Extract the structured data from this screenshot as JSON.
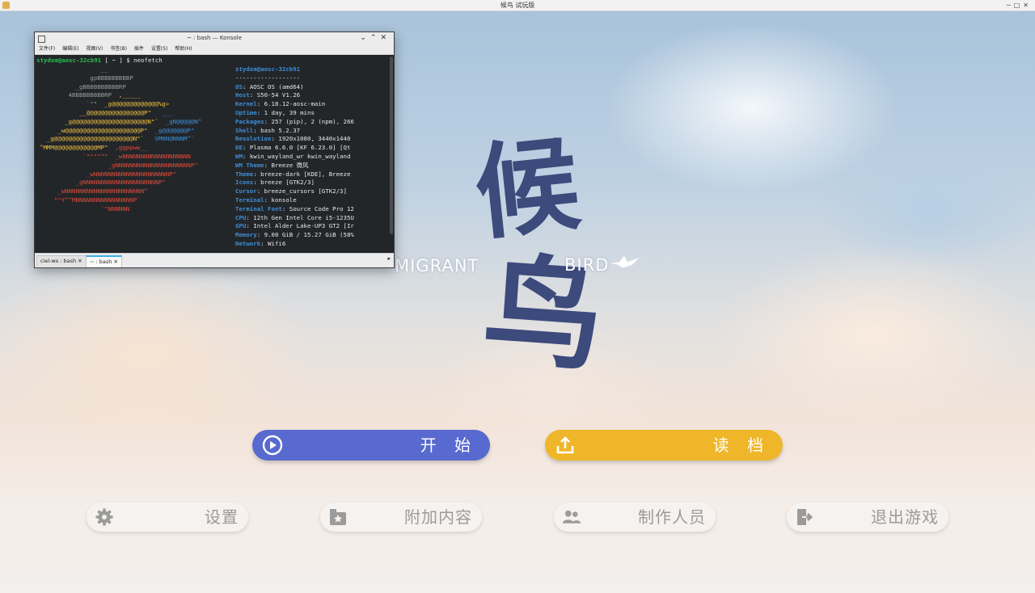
{
  "window": {
    "title": "候鸟 试玩版"
  },
  "terminal": {
    "title": "~ : bash — Konsole",
    "menu": [
      "文件(F)",
      "编辑(E)",
      "视图(V)",
      "书签(B)",
      "插件",
      "设置(S)",
      "帮助(H)"
    ],
    "prompt_user": "stydxm@aosc-32cb91",
    "prompt_rest": " [ ~ ] $ neofetch",
    "host_line": "stydxm@aosc-32cb91",
    "separator": "------------------",
    "info": [
      {
        "key": "OS",
        "value": "AOSC OS (amd64)"
      },
      {
        "key": "Host",
        "value": "S50-54 V1.26"
      },
      {
        "key": "Kernel",
        "value": "6.18.12-aosc-main"
      },
      {
        "key": "Uptime",
        "value": "1 day, 39 mins"
      },
      {
        "key": "Packages",
        "value": "257 (pip), 2 (npm), 266"
      },
      {
        "key": "Shell",
        "value": "bash 5.2.37"
      },
      {
        "key": "Resolution",
        "value": "1920x1080, 3440x1440"
      },
      {
        "key": "DE",
        "value": "Plasma 6.6.0 [KF 6.23.0] [Qt"
      },
      {
        "key": "WM",
        "value": "kwin_wayland_wr kwin_wayland"
      },
      {
        "key": "WM Theme",
        "value": "Breeze 微风"
      },
      {
        "key": "Theme",
        "value": "breeze-dark [KDE], Breeze"
      },
      {
        "key": "Icons",
        "value": "breeze [GTK2/3]"
      },
      {
        "key": "Cursor",
        "value": "breeze_cursors [GTK2/3]"
      },
      {
        "key": "Terminal",
        "value": "konsole"
      },
      {
        "key": "Terminal Font",
        "value": "Source Code Pro 12"
      },
      {
        "key": "CPU",
        "value": "12th Gen Intel Core i5-1235U"
      },
      {
        "key": "GPU",
        "value": "Intel Alder Lake-UP3 GT2 [Ir"
      },
      {
        "key": "Memory",
        "value": "9.00 GiB / 15.27 GiB (58%"
      },
      {
        "key": "Network",
        "value": "Wifi6"
      }
    ],
    "tabs": [
      "ciel-ws : bash",
      "~ : bash"
    ]
  },
  "game": {
    "logo_char_1": "候",
    "logo_char_2": "鸟",
    "logo_en_1": "MIGRANT",
    "logo_en_2": "BIRD",
    "start_label": "开 始",
    "load_label": "读 档",
    "settings_label": "设置",
    "extra_label": "附加内容",
    "credits_label": "制作人员",
    "exit_label": "退出游戏"
  },
  "colors": {
    "start": "#5869cf",
    "load": "#efb629",
    "logo": "#3c4a7c",
    "term_bg": "#232629",
    "art_yellow": "#f0c040",
    "art_blue": "#3b8fd9",
    "art_red": "#e04a3a"
  },
  "icons": [
    "play-icon",
    "upload-icon",
    "gear-icon",
    "box-star-icon",
    "users-icon",
    "exit-door-icon",
    "paper-bird-icon"
  ]
}
